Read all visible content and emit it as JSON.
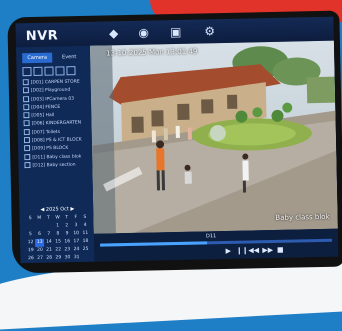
{
  "app": {
    "title": "NVR"
  },
  "sidebar": {
    "tabs": [
      "Camera",
      "Event"
    ],
    "cameras": [
      "[D01] CARPEN STORE",
      "[D02] Playground",
      "[D03] IPCamera 03",
      "[D04] FENCE",
      "[D05] Hall",
      "[D06] KINDERGARTEN",
      "[D07] Toilets",
      "[D08] PS & ICT BLOCK",
      "[D09] PS BLOCK",
      "[D11] Baby class blok",
      "[D12] Baby section"
    ],
    "calendar": {
      "year": "2025",
      "month": "Oct",
      "days": [
        "S",
        "M",
        "T",
        "W",
        "T",
        "F",
        "S",
        "",
        "",
        "",
        "1",
        "2",
        "3",
        "4",
        "5",
        "6",
        "7",
        "8",
        "9",
        "10",
        "11",
        "12",
        "13",
        "14",
        "15",
        "16",
        "17",
        "18",
        "19",
        "20",
        "21",
        "22",
        "23",
        "24",
        "25",
        "26",
        "27",
        "28",
        "29",
        "30",
        "31",
        ""
      ],
      "selected_day": "13"
    }
  },
  "video": {
    "timestamp": "13-10-2025 Mon 13:01:49",
    "camera_name": "Baby class blok"
  },
  "playback": {
    "channel_label": "D11",
    "progress": 0.46
  },
  "colors": {
    "accent": "#2c6be0",
    "frame_blue": "#1f7fc6",
    "frame_red": "#e2332b"
  }
}
